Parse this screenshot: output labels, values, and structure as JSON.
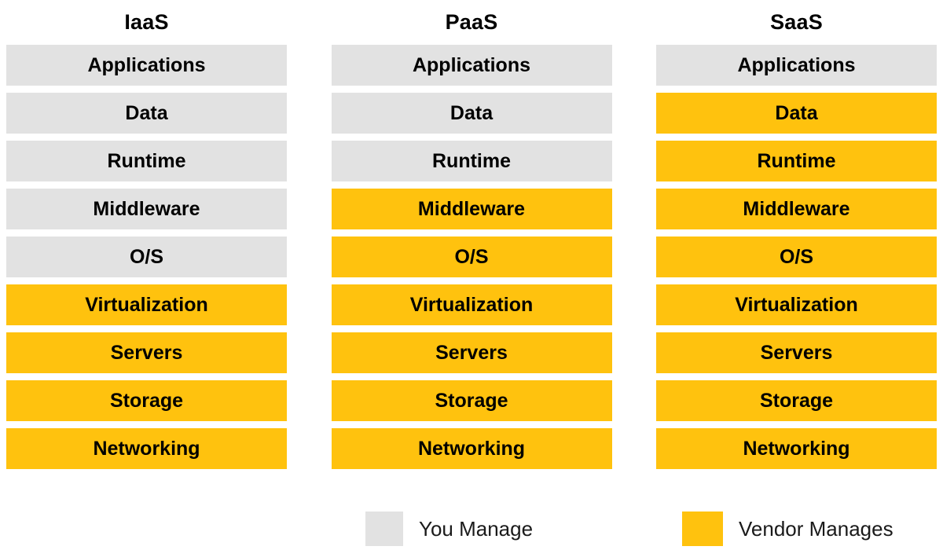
{
  "colors": {
    "you_manage": "#e2e2e2",
    "vendor_manages": "#ffc20e",
    "text": "#000000",
    "background": "#ffffff"
  },
  "columns": [
    {
      "title": "IaaS",
      "layers": [
        {
          "label": "Applications",
          "owner": "you-manage"
        },
        {
          "label": "Data",
          "owner": "you-manage"
        },
        {
          "label": "Runtime",
          "owner": "you-manage"
        },
        {
          "label": "Middleware",
          "owner": "you-manage"
        },
        {
          "label": "O/S",
          "owner": "you-manage"
        },
        {
          "label": "Virtualization",
          "owner": "vendor-manages"
        },
        {
          "label": "Servers",
          "owner": "vendor-manages"
        },
        {
          "label": "Storage",
          "owner": "vendor-manages"
        },
        {
          "label": "Networking",
          "owner": "vendor-manages"
        }
      ]
    },
    {
      "title": "PaaS",
      "layers": [
        {
          "label": "Applications",
          "owner": "you-manage"
        },
        {
          "label": "Data",
          "owner": "you-manage"
        },
        {
          "label": "Runtime",
          "owner": "you-manage"
        },
        {
          "label": "Middleware",
          "owner": "vendor-manages"
        },
        {
          "label": "O/S",
          "owner": "vendor-manages"
        },
        {
          "label": "Virtualization",
          "owner": "vendor-manages"
        },
        {
          "label": "Servers",
          "owner": "vendor-manages"
        },
        {
          "label": "Storage",
          "owner": "vendor-manages"
        },
        {
          "label": "Networking",
          "owner": "vendor-manages"
        }
      ]
    },
    {
      "title": "SaaS",
      "layers": [
        {
          "label": "Applications",
          "owner": "you-manage"
        },
        {
          "label": "Data",
          "owner": "vendor-manages"
        },
        {
          "label": "Runtime",
          "owner": "vendor-manages"
        },
        {
          "label": "Middleware",
          "owner": "vendor-manages"
        },
        {
          "label": "O/S",
          "owner": "vendor-manages"
        },
        {
          "label": "Virtualization",
          "owner": "vendor-manages"
        },
        {
          "label": "Servers",
          "owner": "vendor-manages"
        },
        {
          "label": "Storage",
          "owner": "vendor-manages"
        },
        {
          "label": "Networking",
          "owner": "vendor-manages"
        }
      ]
    }
  ],
  "legend": [
    {
      "label": "You Manage",
      "owner": "you-manage"
    },
    {
      "label": "Vendor Manages",
      "owner": "vendor-manages"
    }
  ]
}
